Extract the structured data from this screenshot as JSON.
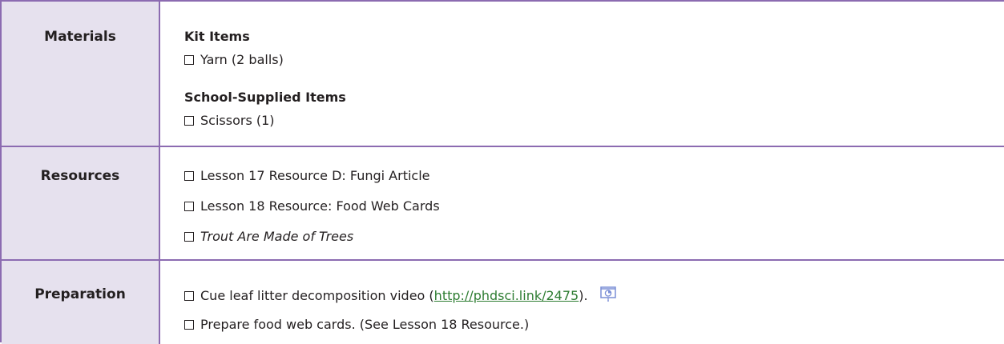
{
  "materials": {
    "label": "Materials",
    "kit_heading": "Kit Items",
    "kit_items": [
      "Yarn (2 balls)"
    ],
    "school_heading": "School-Supplied Items",
    "school_items": [
      "Scissors (1)"
    ]
  },
  "resources": {
    "label": "Resources",
    "items": [
      "Lesson 17 Resource D: Fungi Article",
      "Lesson 18 Resource: Food Web Cards",
      "Trout Are Made of Trees"
    ]
  },
  "preparation": {
    "label": "Preparation",
    "item1_pre": "Cue leaf litter decomposition video (",
    "item1_link": "http://phdsci.link/2475",
    "item1_post": ").",
    "item1_icon": "slide-icon",
    "item2": "Prepare food web cards. (See Lesson 18 Resource.)"
  },
  "colors": {
    "border": "#8c6bb1",
    "label_bg": "#e6e1ee",
    "link": "#2e7d32",
    "icon": "#7b8fd6"
  }
}
